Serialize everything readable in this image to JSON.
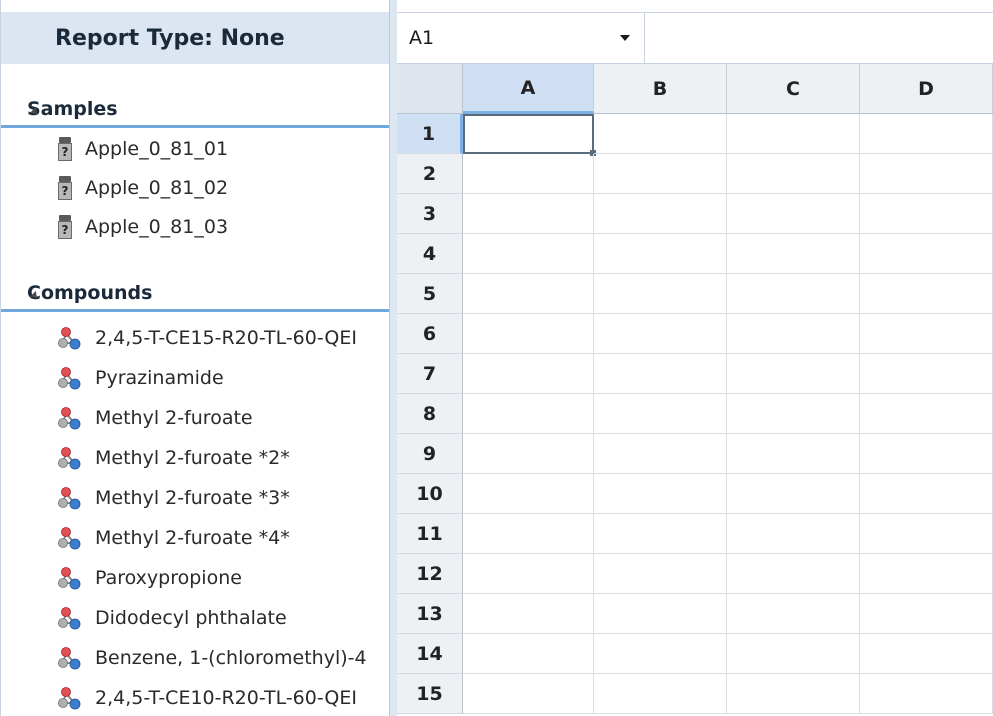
{
  "report_header": {
    "label": "Report Type: None"
  },
  "samples": {
    "header": "Samples",
    "items": [
      {
        "label": "Apple_0_81_01",
        "icon": "unknown-sample-vial-icon"
      },
      {
        "label": "Apple_0_81_02",
        "icon": "unknown-sample-vial-icon"
      },
      {
        "label": "Apple_0_81_03",
        "icon": "unknown-sample-vial-icon"
      }
    ]
  },
  "compounds": {
    "header": "Compounds",
    "items": [
      {
        "label": "2,4,5-T-CE15-R20-TL-60-QEI",
        "icon": "molecule-icon"
      },
      {
        "label": "Pyrazinamide",
        "icon": "molecule-icon"
      },
      {
        "label": "Methyl 2-furoate",
        "icon": "molecule-icon"
      },
      {
        "label": "Methyl 2-furoate *2*",
        "icon": "molecule-icon"
      },
      {
        "label": "Methyl 2-furoate *3*",
        "icon": "molecule-icon"
      },
      {
        "label": "Methyl 2-furoate *4*",
        "icon": "molecule-icon"
      },
      {
        "label": "Paroxypropione",
        "icon": "molecule-icon"
      },
      {
        "label": "Didodecyl phthalate",
        "icon": "molecule-icon"
      },
      {
        "label": "Benzene, 1-(chloromethyl)-4",
        "icon": "molecule-icon"
      },
      {
        "label": "2,4,5-T-CE10-R20-TL-60-QEI",
        "icon": "molecule-icon"
      }
    ]
  },
  "spreadsheet": {
    "name_box": "A1",
    "formula": "",
    "active_cell": "A1",
    "columns": [
      "A",
      "B",
      "C",
      "D"
    ],
    "rows": [
      "1",
      "2",
      "3",
      "4",
      "5",
      "6",
      "7",
      "8",
      "9",
      "10",
      "11",
      "12",
      "13",
      "14",
      "15"
    ]
  },
  "colors": {
    "panel_header_bg": "#dce6f2",
    "group_underline": "#6fa8dc",
    "selected_header_bg": "#cfe0f4",
    "grid_line": "#d9dee3"
  }
}
